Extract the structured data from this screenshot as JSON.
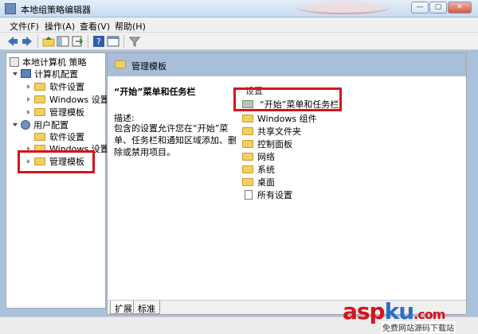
{
  "window": {
    "title": "本地组策略编辑器",
    "controls": {
      "minimize": "—",
      "maximize": "▢",
      "close": "✕"
    }
  },
  "menu": {
    "items": [
      "文件(F)",
      "操作(A)",
      "查看(V)",
      "帮助(H)"
    ]
  },
  "toolbar": {
    "icons": [
      "back-icon",
      "forward-icon",
      "up-folder-icon",
      "show-hide-tree-icon",
      "export-list-icon",
      "help-icon",
      "properties-icon",
      "filter-icon"
    ]
  },
  "tree": {
    "root": "本地计算机 策略",
    "computer_config": "计算机配置",
    "computer_children": [
      "软件设置",
      "Windows 设置",
      "管理模板"
    ],
    "user_config": "用户配置",
    "user_children": [
      "软件设置",
      "Windows 设置",
      "管理模板"
    ]
  },
  "main": {
    "section_title": "管理模板",
    "desc_title": "“开始”菜单和任务栏",
    "desc_label": "描述:",
    "desc_text": "包含的设置允许您在“开始”菜单、任务栏和通知区域添加、删除或禁用项目。",
    "list_header": "设置",
    "list_items": [
      "“开始”菜单和任务栏",
      "Windows 组件",
      "共享文件夹",
      "控制面板",
      "网络",
      "系统",
      "桌面",
      "所有设置"
    ]
  },
  "tabs": [
    "扩展",
    "标准"
  ],
  "watermark": {
    "main": "asp",
    "ku": "ku",
    "suffix": ".com",
    "sub": "免费网站源码下载站"
  },
  "colors": {
    "highlight_red": "#d4141c",
    "header_blue": "#a9bfd9",
    "folder_yellow": "#f3cf62"
  }
}
